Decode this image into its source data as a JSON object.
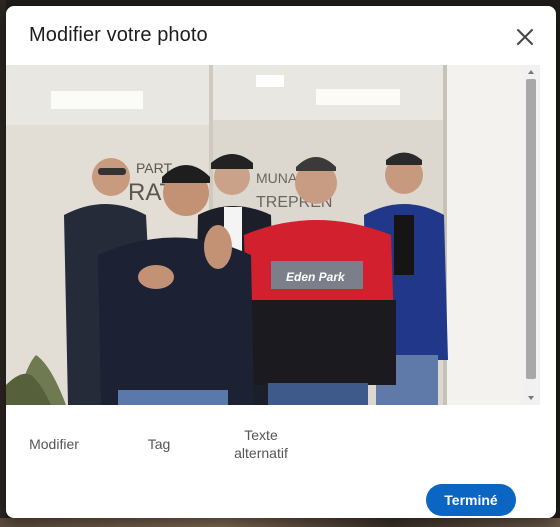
{
  "modal": {
    "title": "Modifier votre photo",
    "close_icon": "close-icon"
  },
  "photo": {
    "description_icon": "photo",
    "shirt_text": "Eden Park"
  },
  "actions": [
    {
      "label": "Modifier"
    },
    {
      "label": "Tag"
    },
    {
      "label_line1": "Texte",
      "label_line2": "alternatif"
    }
  ],
  "footer": {
    "done_label": "Terminé"
  },
  "colors": {
    "primary": "#0a66c2",
    "scroll_thumb": "#a8a8a8"
  }
}
